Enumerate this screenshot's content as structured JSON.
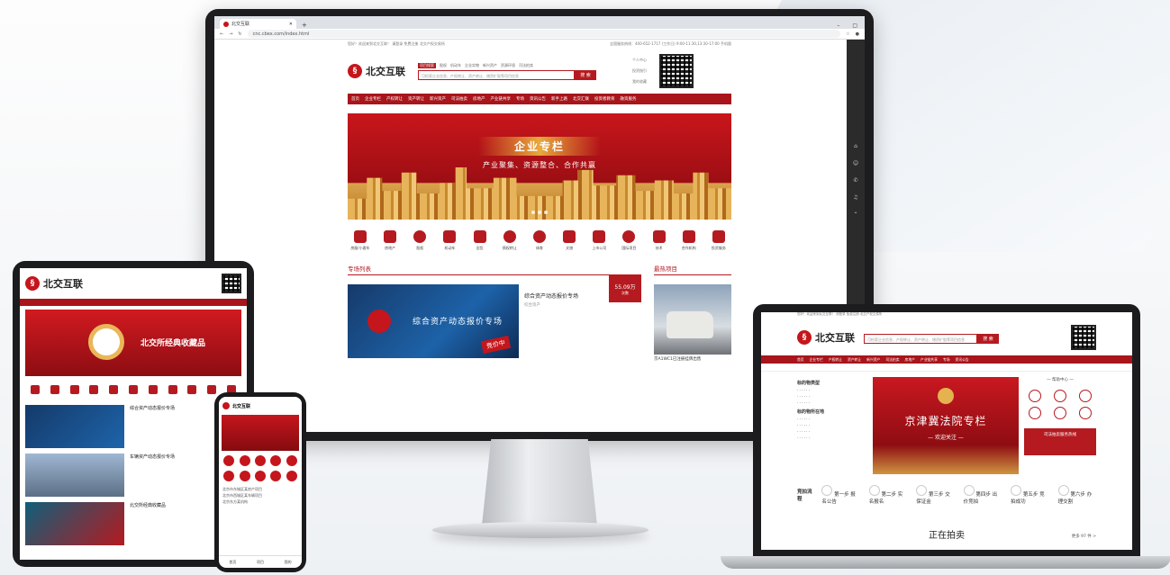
{
  "browser": {
    "tab_title": "北交互联",
    "url": "cnc.cbex.com/index.html"
  },
  "site": {
    "top_left": "您好！欢迎来到北交互联！  请登录  免费注册  北交产权交易所",
    "top_right": "全国服务热线：400-652-1717  (工作日) 9:00-11:30,13:30-17:00  手机版",
    "logo_text": "北交互联",
    "search_tabs": [
      "项目搜索",
      "股权",
      "机动车",
      "企业实物",
      "新兴资产",
      "资源环境",
      "司法拍卖"
    ],
    "search_placeholder": "可检索企业信息、产权转让、资产转让、增资扩股等项目信息",
    "search_button": "搜 索",
    "user_links": [
      "个人中心",
      "投资指引",
      "我的收藏"
    ],
    "nav": [
      "首页",
      "企业专栏",
      "产权转让",
      "资产转让",
      "新兴资产",
      "司法拍卖",
      "房地产",
      "产业链共享",
      "专场",
      "资讯公告",
      "新手上路",
      "北交汇联",
      "投资者教育",
      "融资服务"
    ]
  },
  "banner": {
    "title": "企业专栏",
    "subtitle": "产业聚集、资源整合、合作共赢"
  },
  "categories": [
    "房屋/小客车",
    "房地产",
    "股权",
    "机动车",
    "旧货",
    "债权转让",
    "体育",
    "文旅",
    "上市公司",
    "国际项目",
    "技术",
    "合作机构",
    "投资服务"
  ],
  "sections": {
    "special_title": "专场列表",
    "hot_title": "最热项目",
    "special_card": {
      "image_text": "综合资产动态报价专场",
      "badge": "竞价中",
      "name": "综合资产动态报价专场",
      "category": "综合资产",
      "price": "55.09万",
      "price_label": "次数"
    },
    "hot_caption": "京A1WC1已注册挂牌出售"
  },
  "tablet": {
    "banner": "北交所经典收藏品",
    "rows": [
      "综合资产动态报价专场",
      "车辆资产动态报价专场",
      "北交所经典收藏品"
    ]
  },
  "phone": {
    "title": "北交互联",
    "list": [
      "北京市东城区某房产项目",
      "北京市西城区某车辆项目",
      "北京东方某机构"
    ],
    "tabs": [
      "首页",
      "项目",
      "我的"
    ]
  },
  "laptop": {
    "left_title_1": "标的物类型",
    "left_title_2": "标的物所在地",
    "banner_title": "京津冀法院专栏",
    "banner_sub": "— 欢迎关注 —",
    "help_title": "一 帮助中心 一",
    "help_box": "司法拍卖服务热线",
    "flow_label": "竞拍流程",
    "flow_steps": [
      "第一步 报名公告",
      "第二步 实名报名",
      "第三步 交保证金",
      "第四步 出价竞拍",
      "第五步 竞拍成功",
      "第六步 办理交割"
    ],
    "live_title": "正在拍卖",
    "more": "更多 97 件 >"
  }
}
